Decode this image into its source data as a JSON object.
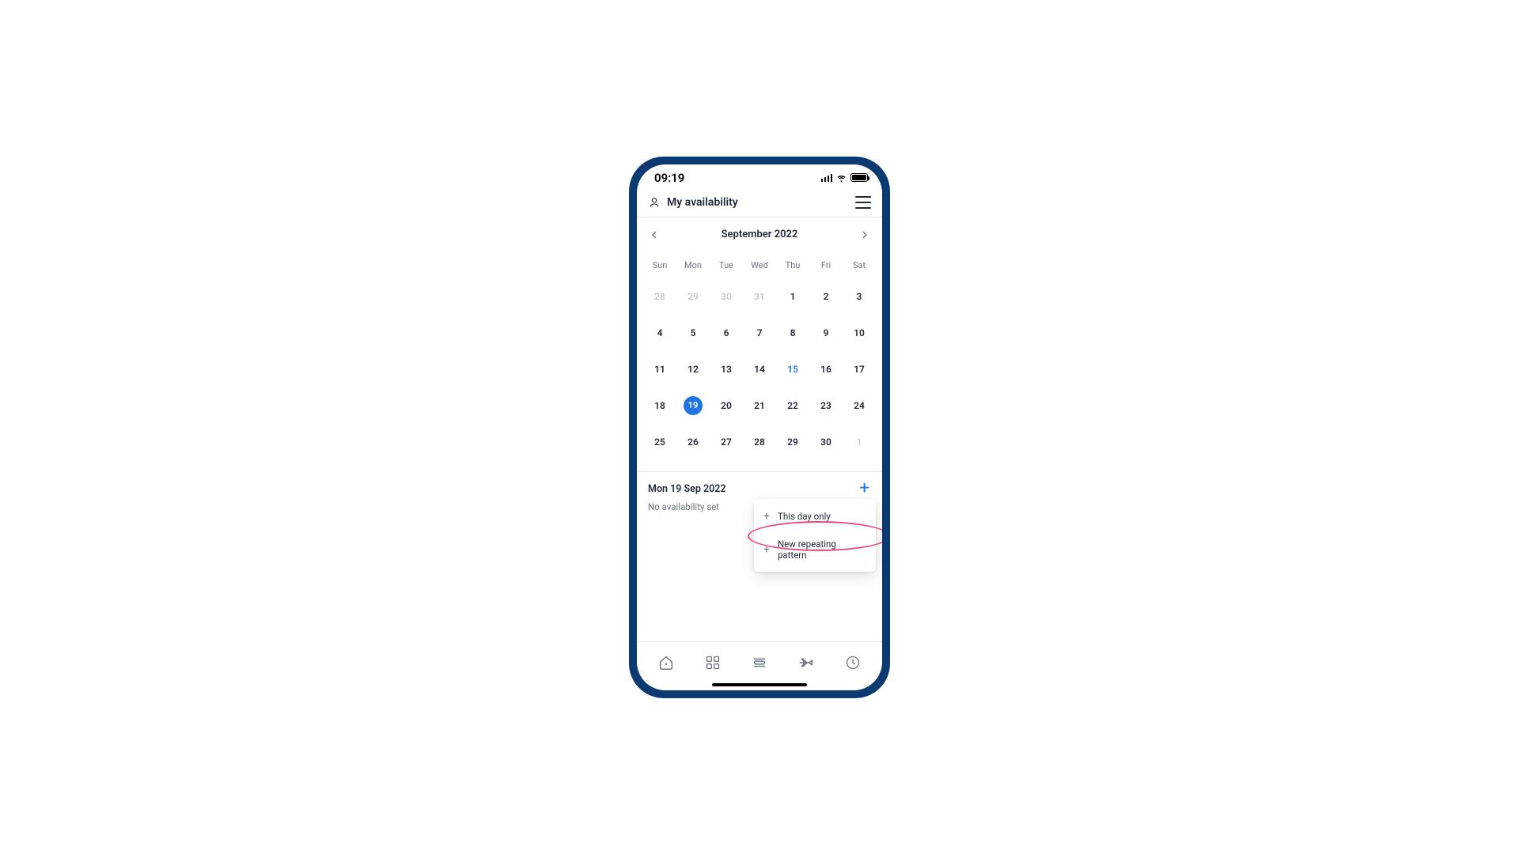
{
  "status": {
    "time": "09:19"
  },
  "header": {
    "title": "My availability"
  },
  "calendar": {
    "month_label": "September 2022",
    "weekdays": [
      "Sun",
      "Mon",
      "Tue",
      "Wed",
      "Thu",
      "Fri",
      "Sat"
    ],
    "rows": [
      [
        {
          "n": "28",
          "muted": true
        },
        {
          "n": "29",
          "muted": true
        },
        {
          "n": "30",
          "muted": true
        },
        {
          "n": "31",
          "muted": true
        },
        {
          "n": "1"
        },
        {
          "n": "2"
        },
        {
          "n": "3"
        }
      ],
      [
        {
          "n": "4"
        },
        {
          "n": "5"
        },
        {
          "n": "6"
        },
        {
          "n": "7"
        },
        {
          "n": "8"
        },
        {
          "n": "9"
        },
        {
          "n": "10"
        }
      ],
      [
        {
          "n": "11"
        },
        {
          "n": "12"
        },
        {
          "n": "13"
        },
        {
          "n": "14"
        },
        {
          "n": "15",
          "today": true
        },
        {
          "n": "16"
        },
        {
          "n": "17"
        }
      ],
      [
        {
          "n": "18"
        },
        {
          "n": "19",
          "selected": true
        },
        {
          "n": "20"
        },
        {
          "n": "21"
        },
        {
          "n": "22"
        },
        {
          "n": "23"
        },
        {
          "n": "24"
        }
      ],
      [
        {
          "n": "25"
        },
        {
          "n": "26"
        },
        {
          "n": "27"
        },
        {
          "n": "28"
        },
        {
          "n": "29"
        },
        {
          "n": "30"
        },
        {
          "n": "1",
          "muted": true
        }
      ]
    ]
  },
  "detail": {
    "date_label": "Mon 19 Sep 2022",
    "empty_text": "No availability set"
  },
  "menu": {
    "item1": "This day only",
    "item2": "New repeating pattern"
  }
}
